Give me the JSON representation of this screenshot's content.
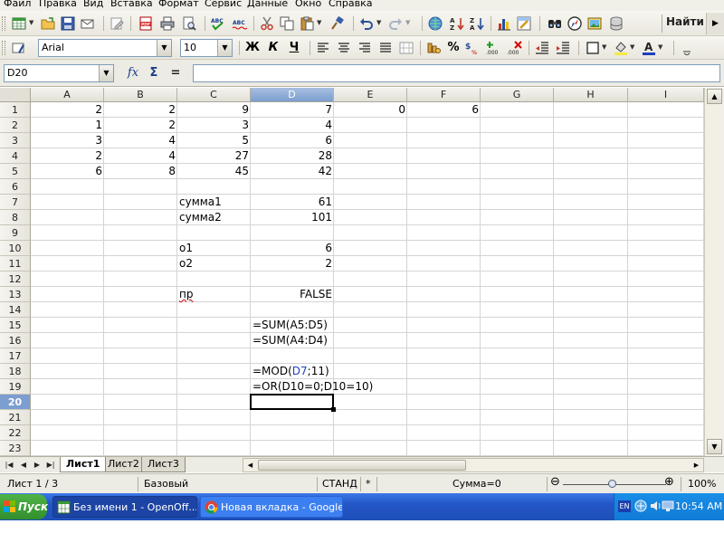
{
  "menu": [
    "Файл",
    "Правка",
    "Вид",
    "Вставка",
    "Формат",
    "Сервис",
    "Данные",
    "Окно",
    "Справка"
  ],
  "toolbar": {
    "find_label": "Найти",
    "font_name": "Arial",
    "font_size": "10",
    "bold": "Ж",
    "italic": "К",
    "underline": "Ч",
    "percent": "%"
  },
  "formula_bar": {
    "cell_ref": "D20",
    "fx": "fx",
    "sum": "Σ",
    "equals": "=",
    "content": ""
  },
  "sheet": {
    "columns": [
      "A",
      "B",
      "C",
      "D",
      "E",
      "F",
      "G",
      "H",
      "I"
    ],
    "selected_column": "D",
    "rows": [
      "1",
      "2",
      "3",
      "4",
      "5",
      "6",
      "7",
      "8",
      "9",
      "10",
      "11",
      "12",
      "13",
      "14",
      "15",
      "16",
      "17",
      "18",
      "19",
      "20",
      "21",
      "22",
      "23"
    ],
    "selected_row": "20",
    "cells": {
      "A1": "2",
      "B1": "2",
      "C1": "9",
      "D1": "7",
      "E1": "0",
      "F1": "6",
      "A2": "1",
      "B2": "2",
      "C2": "3",
      "D2": "4",
      "A3": "3",
      "B3": "4",
      "C3": "5",
      "D3": "6",
      "A4": "2",
      "B4": "4",
      "C4": "27",
      "D4": "28",
      "A5": "6",
      "B5": "8",
      "C5": "45",
      "D5": "42",
      "C7": "сумма1",
      "D7": "61",
      "C8": "сумма2",
      "D8": "101",
      "C10": "о1",
      "D10": "6",
      "C11": "о2",
      "D11": "2",
      "C13": "пр",
      "D13": "FALSE",
      "D15": "=SUM(A5:D5)",
      "D16": "=SUM(A4:D4)",
      "D18_pre": "=MOD(",
      "D18_ref": "D7",
      "D18_post": ";11)",
      "D19": "=OR(D10=0;D10=10)"
    }
  },
  "tabs": [
    "Лист1",
    "Лист2",
    "Лист3"
  ],
  "active_tab": "Лист1",
  "status": {
    "sheet": "Лист 1 / 3",
    "style": "Базовый",
    "mode": "СТАНД",
    "modified": "*",
    "sum": "Сумма=0",
    "zoom_minus": "⊖",
    "zoom_plus": "⊕",
    "zoom": "100%",
    "zoom_level_percent": 100
  },
  "taskbar": {
    "start": "Пуск",
    "tasks": [
      "Без имени 1 - OpenOff...",
      "Новая вкладка - Google..."
    ],
    "lang": "EN",
    "clock": "10:54 AM"
  },
  "colors": {
    "selection_header": "#7c9ed0",
    "taskbar": "#2356c7",
    "start_button": "#318f2d",
    "reference_text": "#1f3fbf"
  }
}
